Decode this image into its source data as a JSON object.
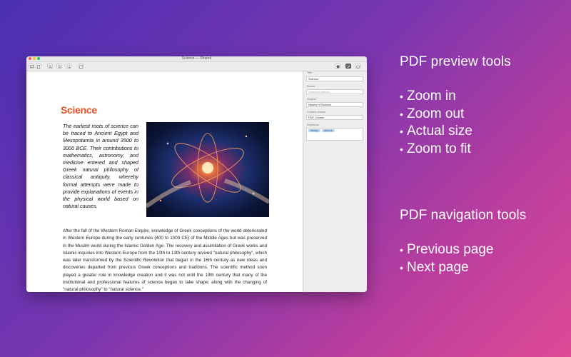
{
  "window": {
    "title": "Science — Shared",
    "toolbar": {
      "left_icons": [
        "sidebar-icon",
        "document-icon",
        "zoom-in-icon",
        "zoom-out-icon",
        "actual-size-icon",
        "zoom-fit-icon"
      ],
      "right_icons": [
        "badge-icon",
        "edit-icon",
        "info-icon"
      ]
    }
  },
  "document": {
    "title": "Science",
    "intro": "The earliest roots of science can be traced to Ancient Egypt and Mesopotamia in around 3500 to 3000 BCE. Their contributions to mathematics, astronomy, and medicine entered and shaped Greek natural philosophy of classical antiquity, whereby formal attempts were made to provide explanations of events in the physical world based on natural causes.",
    "body": "After the fall of the Western Roman Empire, knowledge of Greek conceptions of the world deteriorated in Western Europe during the early centuries (400 to 1000 CE) of the Middle Ages but was preserved in the Muslim world during the Islamic Golden Age. The recovery and assimilation of Greek works and Islamic inquiries into Western Europe from the 10th to 13th century revived \"natural philosophy\", which was later transformed by the Scientific Revolution that began in the 16th century as new ideas and discoveries departed from previous Greek conceptions and traditions. The scientific method soon played a greater role in knowledge creation and it was not until the 19th century that many of the institutional and professional features of science began to take shape; along with the changing of \"natural philosophy\" to \"natural science.\""
  },
  "sidebar": {
    "title_label": "Title",
    "title_value": "Science",
    "author_label": "Author",
    "author_placeholder": "Unknown author",
    "subject_label": "Subject",
    "subject_value": "History of Science",
    "creator_label": "Content creator",
    "creator_value": "PDF Creator",
    "keywords_label": "Keywords",
    "keywords": [
      "history",
      "science"
    ]
  },
  "promo": {
    "heading1": "PDF preview tools",
    "list1": [
      "Zoom in",
      "Zoom out",
      "Actual size",
      "Zoom to fit"
    ],
    "heading2": "PDF navigation tools",
    "list2": [
      "Previous page",
      "Next page"
    ],
    "bullet": "•"
  }
}
